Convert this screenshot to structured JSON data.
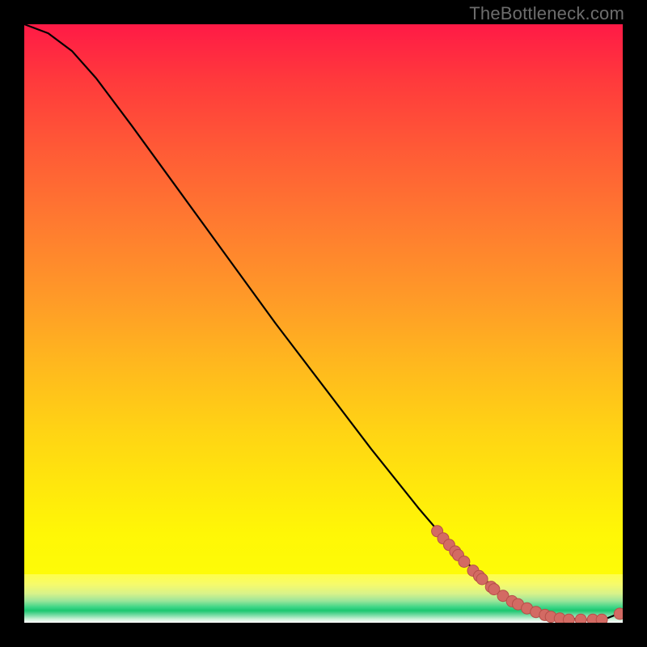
{
  "watermark": "TheBottleneck.com",
  "colors": {
    "background": "#000000",
    "curve": "#000000",
    "point_fill": "#d36a63",
    "point_stroke": "#b64f49",
    "grad_top": "#ff1a46",
    "grad_mid": "#ffe80c",
    "grad_green": "#1bc770"
  },
  "chart_data": {
    "type": "line",
    "title": "",
    "xlabel": "",
    "ylabel": "",
    "xlim": [
      0,
      100
    ],
    "ylim": [
      0,
      100
    ],
    "series": [
      {
        "name": "bottleneck-curve",
        "x": [
          0,
          4,
          8,
          12,
          18,
          26,
          34,
          42,
          50,
          58,
          66,
          72,
          76,
          79,
          82,
          85,
          88,
          91,
          94,
          97,
          100
        ],
        "y": [
          100,
          98.5,
          95.5,
          91,
          83,
          72,
          61,
          50,
          39.5,
          29,
          19,
          12,
          8,
          5.5,
          3.5,
          2,
          1.2,
          0.7,
          0.5,
          0.6,
          1.8
        ]
      }
    ],
    "scatter": [
      {
        "name": "highlighted-points",
        "x": [
          69,
          70,
          71,
          72,
          72.5,
          73.5,
          75,
          76,
          76.5,
          78,
          78.5,
          80,
          81.5,
          82.5,
          84,
          85.5,
          87,
          88,
          89.5,
          91,
          93,
          95,
          96.5,
          99.5
        ],
        "y": [
          15.3,
          14.1,
          13.0,
          11.9,
          11.3,
          10.2,
          8.7,
          7.8,
          7.3,
          6.0,
          5.6,
          4.5,
          3.6,
          3.1,
          2.4,
          1.8,
          1.3,
          1.0,
          0.7,
          0.5,
          0.5,
          0.5,
          0.5,
          1.5
        ]
      }
    ]
  }
}
